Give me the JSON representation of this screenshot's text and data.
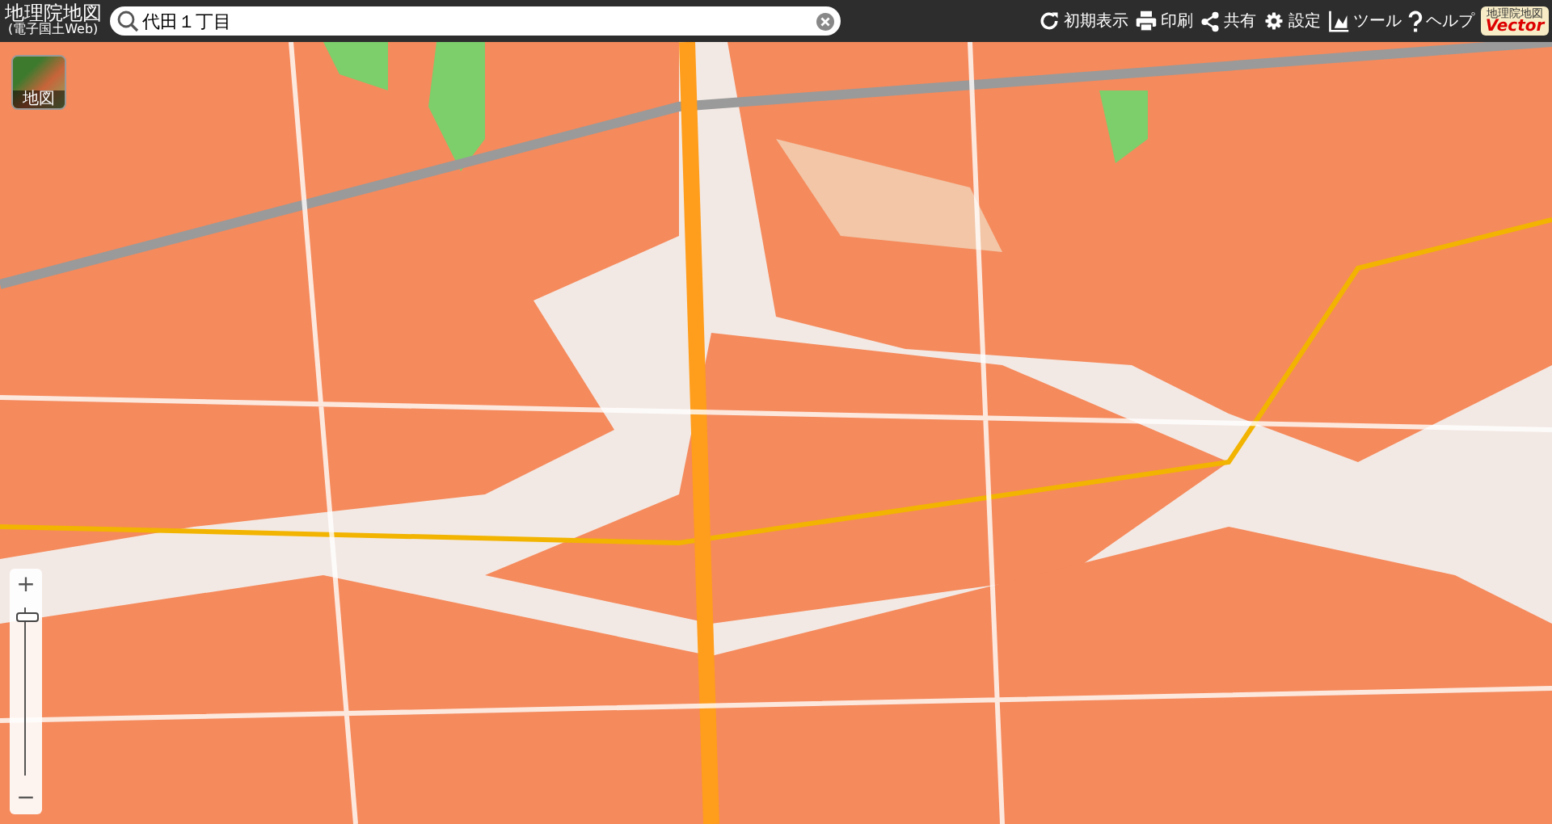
{
  "header": {
    "title": "地理院地図",
    "subtitle": "(電子国土Web)",
    "search": {
      "value": "代田１丁目"
    },
    "tools": [
      {
        "kind": "reset",
        "label": "初期表示"
      },
      {
        "kind": "print",
        "label": "印刷"
      },
      {
        "kind": "share",
        "label": "共有"
      },
      {
        "kind": "settings",
        "label": "設定"
      },
      {
        "kind": "tool",
        "label": "ツール"
      },
      {
        "kind": "help",
        "label": "ヘルプ"
      }
    ],
    "badge": {
      "top": "地理院地図",
      "bottom": "Vector"
    }
  },
  "map": {
    "layer_button": {
      "label": "地図"
    },
    "zoom": {
      "plus": "+",
      "minus": "−",
      "level": 0.92
    }
  }
}
